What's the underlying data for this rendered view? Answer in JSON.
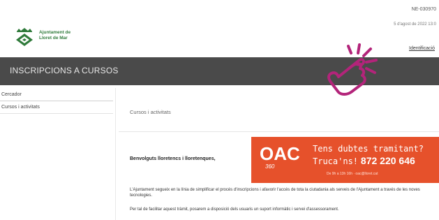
{
  "header": {
    "id_text": "NE-030970",
    "date_text": "5 d'agost de 2022 13:0",
    "login_link": "Identificació"
  },
  "logo": {
    "name_line1": "Ajuntament de",
    "name_line2": "Lloret de Mar"
  },
  "banner": {
    "title": "INSCRIPCIONS A CURSOS"
  },
  "sidebar": {
    "items": [
      {
        "label": "Cercador"
      },
      {
        "label": "Cursos i activitats"
      }
    ]
  },
  "content": {
    "breadcrumb": "Cursos i activitats",
    "greeting": "Benvolguts lloretencs i lloretenques,",
    "para1": "L'Ajuntament segueix en la línia de simplificar el procés d'inscripcions i afavorir l'accés de tota la ciutadania als serveis de l'Ajuntament a través de les noves tecnologies.",
    "para2": "Per tal de facilitar aquest tràmit, posarem a disposició dels usuaris un suport informàtic i servei d'assessorament."
  },
  "oac_ad": {
    "logo": "OAC",
    "sub": "360",
    "line1": "Tens dubtes tramitant?",
    "line2_script": "Truca'ns!",
    "phone": "872 220 646",
    "contact": "De 9h a 13h 16h · oac@lloret.cat"
  },
  "colors": {
    "banner_bg": "#4a4a4a",
    "oac_orange": "#e6512b",
    "logo_green": "#2f7a3a",
    "hand_magenta": "#b3247a"
  },
  "icons": {
    "logo": "ajuntament-shield-icon",
    "pointer": "tap-hand-icon"
  }
}
